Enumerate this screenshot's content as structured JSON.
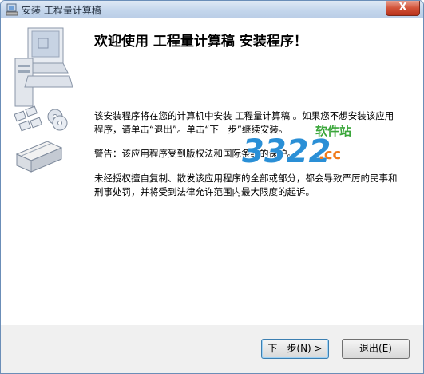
{
  "window": {
    "title": "安装 工程量计算稿",
    "close_glyph": "X"
  },
  "main": {
    "heading": "欢迎使用 工程量计算稿 安装程序！",
    "paragraph1": "该安装程序将在您的计算机中安装 工程量计算稿 。如果您不想安装该应用程序，请单击“退出”。单击“下一步”继续安装。",
    "paragraph2": "警告：该应用程序受到版权法和国际条约的保护。",
    "paragraph3": "未经授权擅自复制、散发该应用程序的全部或部分，都会导致严厉的民事和刑事处罚，并将受到法律允许范围内最大限度的起诉。"
  },
  "watermark": {
    "number": "3322",
    "domain": ".cc",
    "label": "软件站",
    "colors": {
      "number": "#2a8fd6",
      "domain": "#f07a1a",
      "label": "#3aa63a"
    }
  },
  "buttons": {
    "next": "下一步(N) >",
    "exit": "退出(E)"
  }
}
